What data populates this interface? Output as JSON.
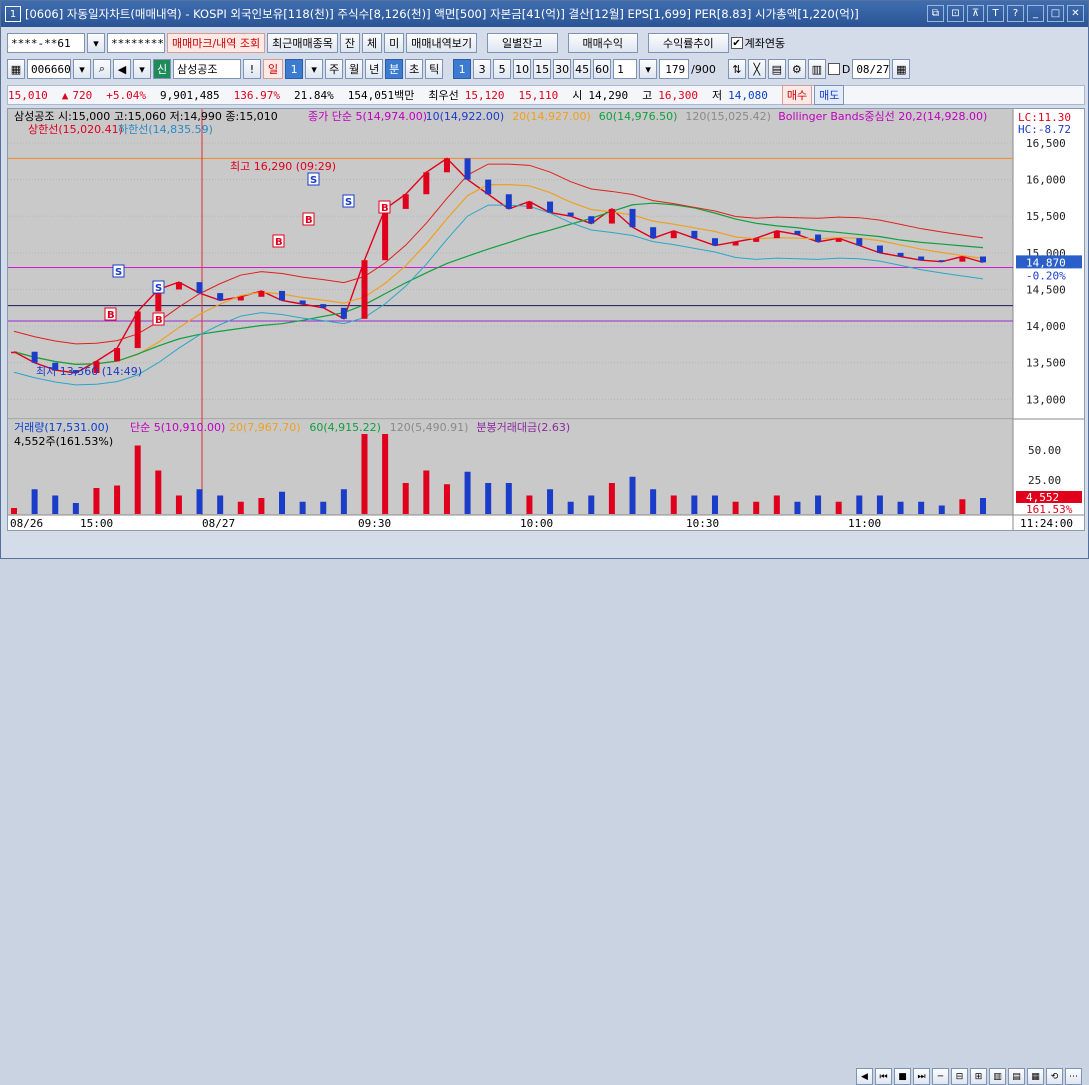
{
  "window": {
    "number": "1",
    "title": "[0606] 자동일자차트(매매내역) - KOSPI 외국인보유[118(천)] 주식수[8,126(천)] 액면[500] 자본금[41(억)] 결산[12월] EPS[1,699] PER[8.83] 시가총액[1,220(억)]",
    "icons": [
      "restore-icon",
      "link-icon",
      "pin-icon",
      "text-icon",
      "help-icon",
      "minimize-icon",
      "maximize-icon",
      "close-icon"
    ],
    "icon_glyphs": [
      "⧉",
      "⊡",
      "⊼",
      "T",
      "?",
      "_",
      "□",
      "✕"
    ]
  },
  "toolbar1": {
    "account": "****-**61",
    "password": "********",
    "btn_mark": "매매마크/내역 조회",
    "btn_recent": "최근매매종목",
    "btn_jan": "잔",
    "btn_che": "체",
    "btn_mi": "미",
    "btn_history": "매매내역보기",
    "btn_daily": "일별잔고",
    "btn_trade_profit": "매매수익",
    "btn_profit_rate": "수익률추이",
    "link_label": "계좌연동"
  },
  "toolbar2": {
    "code": "006660",
    "market_badge": "신",
    "name": "삼성공조",
    "period_il": "일",
    "period_il_num": "1",
    "period_labels": [
      "주",
      "월",
      "년",
      "분",
      "초",
      "틱"
    ],
    "intervals": [
      "1",
      "3",
      "5",
      "10",
      "15",
      "30",
      "45",
      "60"
    ],
    "interval_value": "1",
    "count": "179",
    "count_total": "/900",
    "date_label": "D",
    "date": "08/27"
  },
  "quote": {
    "price": "15,010",
    "change": "720",
    "change_pct": "+5.04%",
    "volume": "9,901,485",
    "vol_ratio": "136.97%",
    "turnover": "21.84%",
    "amount": "154,051백만",
    "best_ask_label": "최우선",
    "best_ask": "15,120",
    "best_bid": "15,110",
    "open_label": "시",
    "open": "14,290",
    "high_label": "고",
    "high": "16,300",
    "low_label": "저",
    "low": "14,080",
    "buy_label": "매수",
    "sell_label": "매도"
  },
  "price_panel": {
    "header": "삼성공조 시:15,000 고:15,060 저:14,990 종:15,010",
    "ma_labels": [
      "종가 단순 5(14,974.00)",
      "10(14,922.00)",
      "20(14,927.00)",
      "60(14,976.50)",
      "120(15,025.42)",
      "Bollinger Bands중심선 20,2(14,928.00)"
    ],
    "ma_colors": [
      "#c000c0",
      "#1a3cc8",
      "#f0a020",
      "#10a040",
      "#8a8a8a",
      "#c000c0"
    ],
    "band_labels": [
      "상한선(15,020.41)",
      "하한선(14,835.59)"
    ],
    "high_note": "최고 16,290 (09:29)",
    "low_note": "최저 13,360 (14:49)",
    "lc": "LC:11.30",
    "hc": "HC:-8.72",
    "price_ticks": [
      "16,500",
      "16,000",
      "15,500",
      "15,000",
      "14,500",
      "14,000",
      "13,500",
      "13,000"
    ],
    "current_price_tag": "14,870",
    "current_pct_tag": "-0.20%"
  },
  "volume_panel": {
    "header": "거래량(17,531.00)",
    "ma_labels": [
      "단순 5(10,910.00)",
      "20(7,967.70)",
      "60(4,915.22)",
      "120(5,490.91)",
      "분봉거래대금(2.63)"
    ],
    "sub_header": "4,552주(161.53%)",
    "vol_ticks": [
      "50.00",
      "25.00"
    ],
    "current_vol_tag": "4,552",
    "current_vol_pct": "161.53%"
  },
  "x_axis": {
    "labels": [
      "08/26",
      "15:00",
      "08/27",
      "09:30",
      "10:00",
      "10:30",
      "11:00",
      "11:24:00"
    ]
  },
  "chart_data": {
    "type": "line",
    "series": [
      {
        "name": "종가",
        "values": [
          13650,
          13500,
          13400,
          13360,
          13520,
          13700,
          14200,
          14500,
          14600,
          14450,
          14350,
          14400,
          14480,
          14350,
          14300,
          14250,
          14100,
          14900,
          15600,
          15800,
          16100,
          16290,
          16000,
          15800,
          15600,
          15700,
          15550,
          15500,
          15400,
          15600,
          15350,
          15200,
          15300,
          15200,
          15100,
          15150,
          15200,
          15300,
          15250,
          15150,
          15200,
          15100,
          15000,
          14950,
          14900,
          14880,
          14950,
          14870
        ]
      }
    ],
    "ylim": [
      12800,
      16800
    ]
  },
  "colors": {
    "up": "#e0001b",
    "down": "#1a3cc8",
    "accent": "#3d7bd1"
  }
}
